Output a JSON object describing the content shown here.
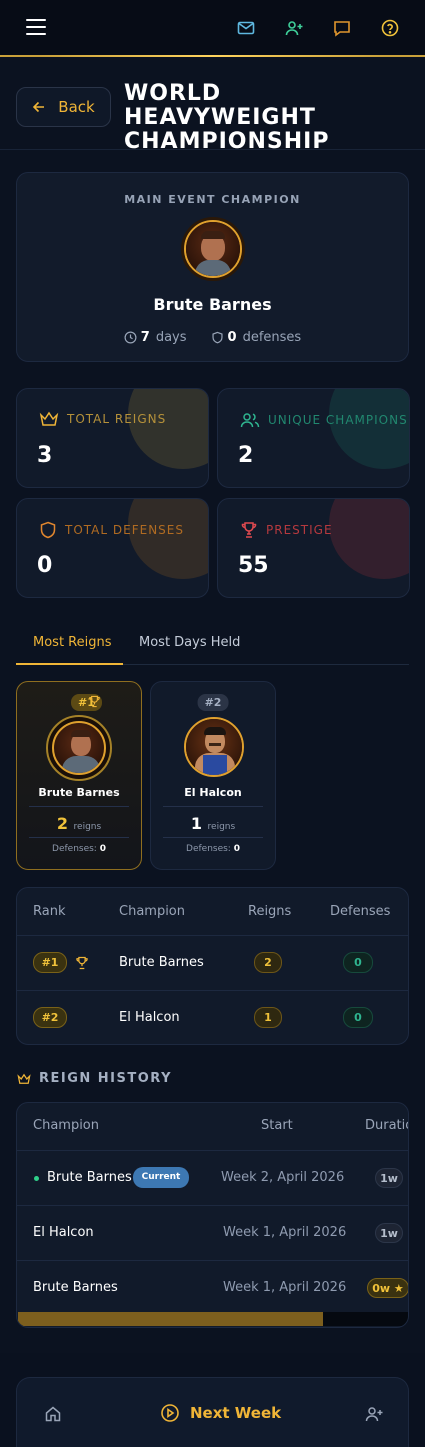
{
  "header": {
    "back_label": "Back",
    "title": "WORLD HEAVYWEIGHT CHAMPIONSHIP"
  },
  "champion": {
    "label": "MAIN EVENT CHAMPION",
    "name": "Brute Barnes",
    "days": "7",
    "days_label": "days",
    "defenses": "0",
    "defenses_label": "defenses"
  },
  "stats": [
    {
      "label": "TOTAL REIGNS",
      "value": "3",
      "color": "#c9a13a",
      "icon": "crown-icon"
    },
    {
      "label": "UNIQUE CHAMPIONS",
      "value": "2",
      "color": "#1f8f73",
      "icon": "users-icon"
    },
    {
      "label": "TOTAL DEFENSES",
      "value": "0",
      "color": "#c97a1e",
      "icon": "shield-icon"
    },
    {
      "label": "PRESTIGE",
      "value": "55",
      "color": "#d23a3f",
      "icon": "trophy-icon"
    }
  ],
  "tabs": [
    "Most Reigns",
    "Most Days Held"
  ],
  "leaders": [
    {
      "rank": "#1",
      "name": "Brute Barnes",
      "reigns": "2",
      "reigns_label": "reigns",
      "def_label": "Defenses:",
      "defenses": "0"
    },
    {
      "rank": "#2",
      "name": "El Halcon",
      "reigns": "1",
      "reigns_label": "reigns",
      "def_label": "Defenses:",
      "defenses": "0"
    }
  ],
  "table": {
    "headers": [
      "Rank",
      "Champion",
      "Reigns",
      "Defenses"
    ],
    "rows": [
      {
        "rank": "#1",
        "champion": "Brute Barnes",
        "reigns": "2",
        "defenses": "0"
      },
      {
        "rank": "#2",
        "champion": "El Halcon",
        "reigns": "1",
        "defenses": "0"
      }
    ]
  },
  "history": {
    "title": "REIGN HISTORY",
    "headers": [
      "Champion",
      "Start",
      "Duratio"
    ],
    "rows": [
      {
        "champion": "Brute Barnes",
        "badge": "Current",
        "start": "Week 2, April 2026",
        "duration": "1w"
      },
      {
        "champion": "El Halcon",
        "badge": "",
        "start": "Week 1, April 2026",
        "duration": "1w"
      },
      {
        "champion": "Brute Barnes",
        "badge": "",
        "start": "Week 1, April 2026",
        "duration": "0w ★"
      }
    ],
    "scroll_fraction": 0.78
  },
  "bottom": {
    "next_label": "Next Week"
  },
  "colors": {
    "accent": "#f0b537",
    "background": "#0b1220",
    "current_badge": "#3d78b3"
  }
}
